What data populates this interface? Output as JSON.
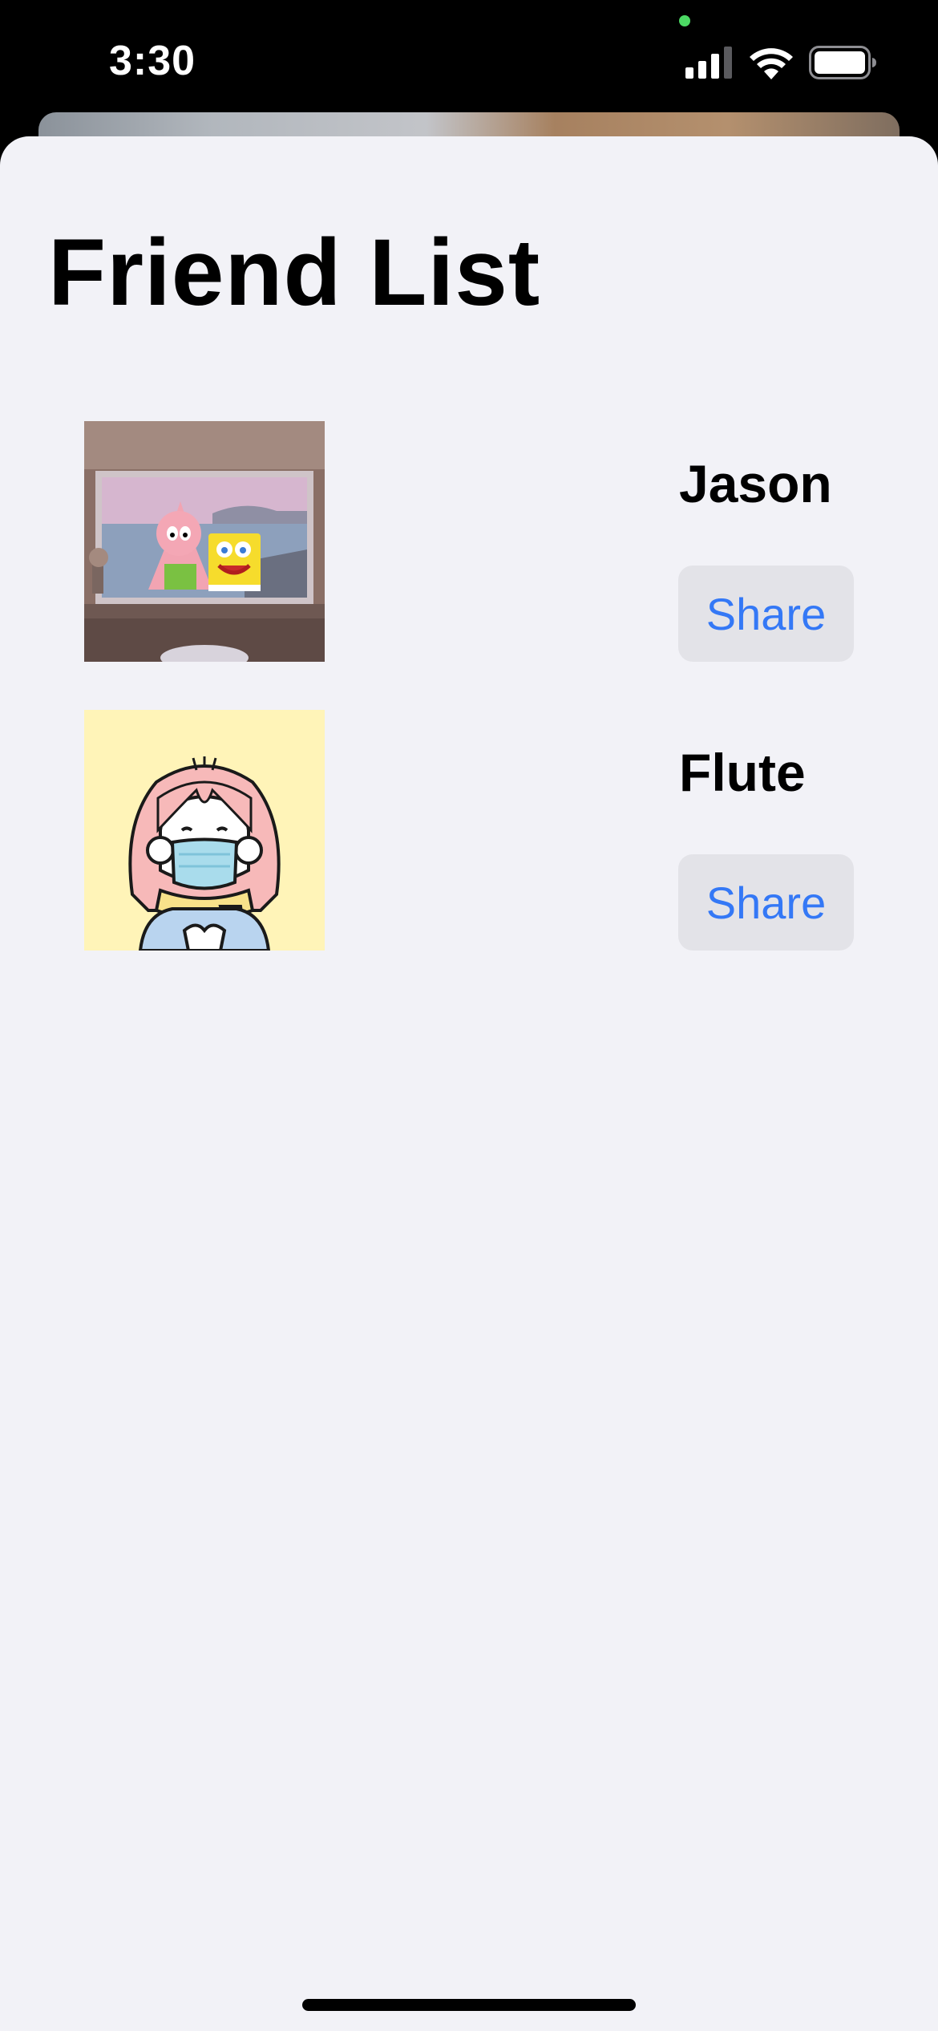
{
  "status_bar": {
    "time": "3:30",
    "icons": [
      "privacy-indicator-dot",
      "cellular-signal-icon",
      "wifi-icon",
      "battery-icon"
    ]
  },
  "page": {
    "title": "Friend List"
  },
  "friends": [
    {
      "name": "Jason",
      "avatar": "cartoon-characters-at-window-avatar",
      "share_label": "Share"
    },
    {
      "name": "Flute",
      "avatar": "masked-girl-illustration-avatar",
      "share_label": "Share"
    }
  ],
  "colors": {
    "background": "#f2f2f7",
    "button_background": "#e3e3e8",
    "accent": "#3478f6",
    "text": "#000000"
  }
}
